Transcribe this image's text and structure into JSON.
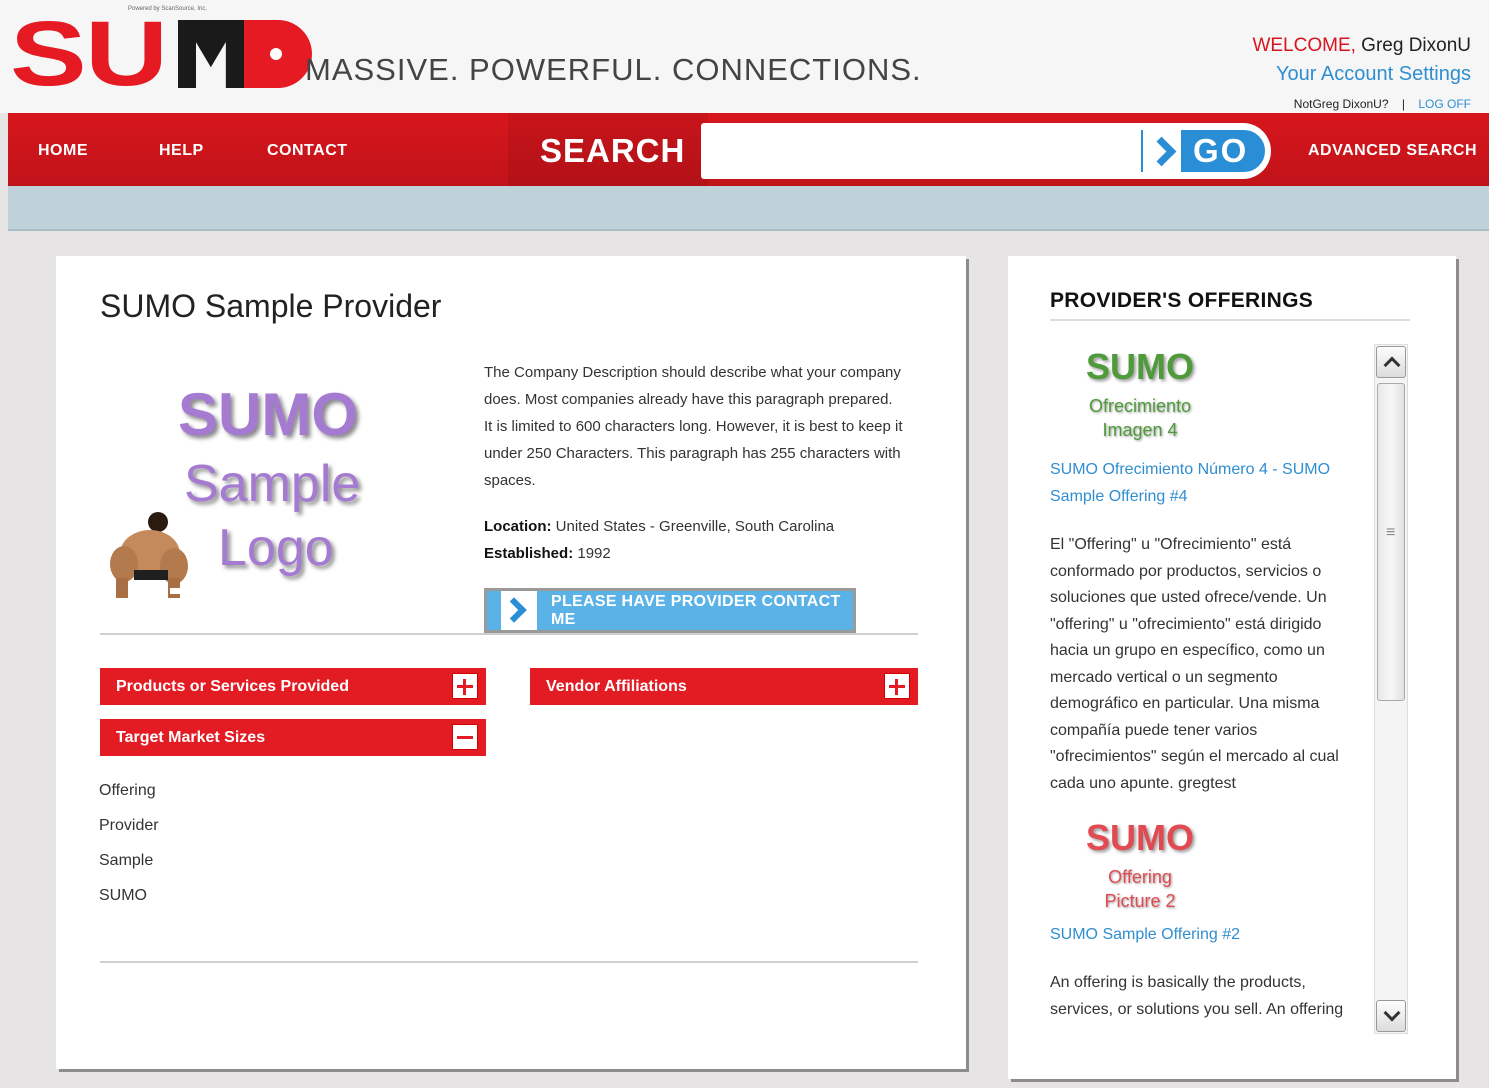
{
  "header": {
    "powered_by": "Powered by ScanSource, Inc.",
    "logo_text": "SUMO",
    "tagline": "MASSIVE. POWERFUL. CONNECTIONS.",
    "welcome_label": "WELCOME,",
    "user_name": "Greg DixonU",
    "account_settings": "Your Account Settings",
    "not_user": "NotGreg DixonU?",
    "separator": "|",
    "log_off": "LOG OFF"
  },
  "nav": {
    "home": "HOME",
    "help": "HELP",
    "contact": "CONTACT",
    "search_label": "SEARCH",
    "search_value": "",
    "go": "GO",
    "advanced_search": "ADVANCED SEARCH"
  },
  "provider": {
    "title": "SUMO Sample Provider",
    "logo_lines": [
      "SUMO",
      "Sample",
      "Logo"
    ],
    "description": "The Company Description should describe what your company does. Most companies already have this paragraph prepared. It is limited to 600 characters long. However, it is best to keep it under 250 Characters. This paragraph has 255 characters with spaces.",
    "location_label": "Location:",
    "location_value": "United States - Greenville, South Carolina",
    "established_label": "Established:",
    "established_value": "1992",
    "contact_button": "PLEASE HAVE PROVIDER CONTACT ME"
  },
  "categories": {
    "products": "Products or Services Provided",
    "vendor": "Vendor Affiliations",
    "target": "Target Market Sizes"
  },
  "tags": [
    "Offering",
    "Provider",
    "Sample",
    "SUMO"
  ],
  "offerings": {
    "title": "PROVIDER'S OFFERINGS",
    "items": [
      {
        "image_lines": [
          "SUMO",
          "Ofrecimiento",
          "Imagen 4"
        ],
        "link": "SUMO Ofrecimiento Número 4 - SUMO Sample Offering #4",
        "description": "El \"Offering\" u \"Ofrecimiento\" está conformado por productos, servicios o soluciones que usted ofrece/vende. Un \"offering\" u \"ofrecimiento\" está dirigido hacia un grupo en específico, como un mercado vertical o un segmento demográfico en particular. Una misma compañía puede tener varios \"ofrecimientos\" según el mercado al cual cada uno apunte. gregtest"
      },
      {
        "image_lines": [
          "SUMO",
          "Offering",
          "Picture 2"
        ],
        "link": "SUMO Sample Offering #2",
        "description": "An offering is basically the products, services, or solutions you sell. An offering"
      }
    ]
  },
  "colors": {
    "brand_red": "#e31b23",
    "link_blue": "#2f8ed1",
    "button_blue": "#5ab2e6"
  }
}
